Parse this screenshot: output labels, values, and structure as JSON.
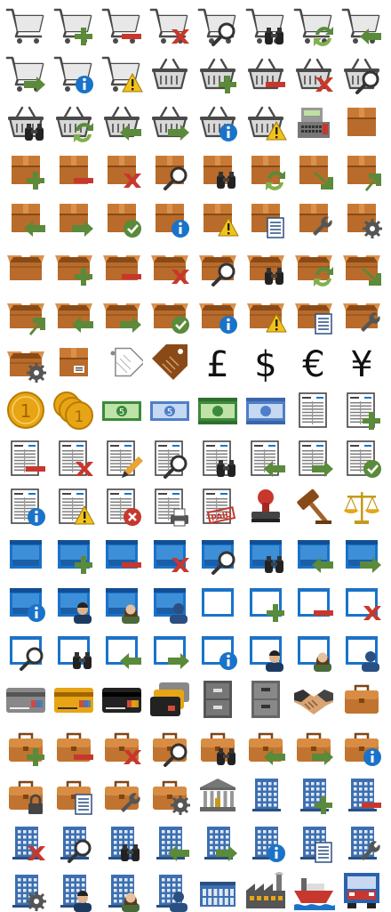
{
  "colors": {
    "cart": "#4a4a4a",
    "green": "#5a8a3a",
    "red": "#c8372d",
    "blue": "#1a73c8",
    "yellow": "#f2c21b",
    "box": "#b86b2a",
    "boxDark": "#8a4a17",
    "money": "#3a8a3a",
    "steel": "#3d6fb0",
    "gold": "#e7a515"
  },
  "rows": [
    [
      "cart",
      "cart-add",
      "cart-remove",
      "cart-delete",
      "cart-search",
      "cart-binoculars",
      "cart-refresh",
      "cart-back"
    ],
    [
      "cart-forward",
      "cart-info",
      "cart-warning",
      "basket",
      "basket-add",
      "basket-remove",
      "basket-delete",
      "basket-search"
    ],
    [
      "basket-binoculars",
      "basket-refresh",
      "basket-back",
      "basket-forward",
      "basket-info",
      "basket-warning",
      "cash-register",
      "box"
    ],
    [
      "box-add",
      "box-remove",
      "box-delete",
      "box-search",
      "box-binoculars",
      "box-refresh",
      "box-into",
      "box-out"
    ],
    [
      "box-back",
      "box-forward",
      "box-ok",
      "box-info",
      "box-warning",
      "box-list",
      "box-wrench",
      "box-gear"
    ],
    [
      "box-open",
      "box-open-add",
      "box-open-remove",
      "box-open-delete",
      "box-open-search",
      "box-open-binoculars",
      "box-open-refresh",
      "box-open-into"
    ],
    [
      "box-open-out",
      "box-open-back",
      "box-open-forward",
      "box-open-ok",
      "box-open-info",
      "box-open-warning",
      "box-open-list",
      "box-open-wrench"
    ],
    [
      "box-open-gear",
      "box-label",
      "price-tag",
      "price-tag-brown",
      "pound",
      "dollar",
      "euro",
      "yen"
    ],
    [
      "coin",
      "coins",
      "banknote-green",
      "banknote-blue",
      "banknotes-green",
      "banknotes-blue",
      "invoice",
      "invoice-add"
    ],
    [
      "invoice-remove",
      "invoice-delete",
      "invoice-edit",
      "invoice-search",
      "invoice-binoculars",
      "invoice-back",
      "invoice-forward",
      "invoice-ok"
    ],
    [
      "invoice-info",
      "invoice-warning",
      "invoice-error",
      "invoice-print",
      "invoice-paid",
      "stamp",
      "gavel",
      "scales"
    ],
    [
      "window",
      "window-add",
      "window-remove",
      "window-delete",
      "window-search",
      "window-binoculars",
      "window-back",
      "window-forward"
    ],
    [
      "window-info",
      "window-user-man",
      "window-user-woman",
      "window-user",
      "frame",
      "frame-add",
      "frame-remove",
      "frame-delete"
    ],
    [
      "frame-search",
      "frame-binoculars",
      "frame-back",
      "frame-forward",
      "frame-info",
      "frame-user-man",
      "frame-user-woman",
      "frame-user"
    ],
    [
      "card-grey",
      "card-gold",
      "card-black",
      "cards",
      "cabinet",
      "cabinet-2",
      "handshake",
      "briefcase"
    ],
    [
      "briefcase-add",
      "briefcase-remove",
      "briefcase-delete",
      "briefcase-search",
      "briefcase-binoculars",
      "briefcase-back",
      "briefcase-forward",
      "briefcase-info"
    ],
    [
      "briefcase-lock",
      "briefcase-list",
      "briefcase-wrench",
      "briefcase-gear",
      "bank",
      "office",
      "office-add",
      "office-remove"
    ],
    [
      "office-delete",
      "office-search",
      "office-binoculars",
      "office-back",
      "office-forward",
      "office-info",
      "office-list",
      "office-wrench"
    ],
    [
      "office-gear",
      "office-user-man",
      "office-user-woman",
      "office-user",
      "building-low",
      "factory",
      "ship",
      "truck"
    ]
  ]
}
